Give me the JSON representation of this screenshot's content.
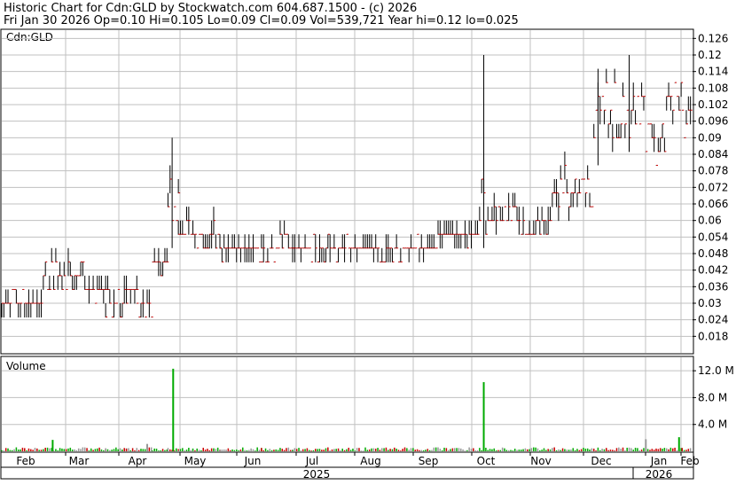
{
  "header": {
    "line1": "Historic Chart for Cdn:GLD by Stockwatch.com 604.687.1500 - (c) 2026",
    "line2": "Fri Jan 30 2026  Op=0.10  Hi=0.105  Lo=0.09  Cl=0.09  Vol=539,721  Year hi=0.12  lo=0.025"
  },
  "price_panel": {
    "label": "Cdn:GLD"
  },
  "volume_panel": {
    "label": "Volume"
  },
  "colors": {
    "up": "#00aa00",
    "down": "#cc0000",
    "neutral": "#999999",
    "grid": "#c0c0c0",
    "bar": "#000000",
    "close_tick": "#cc0000"
  },
  "chart_data": [
    {
      "type": "line",
      "subtype": "ohlc-bars",
      "title": "Historic Chart for Cdn:GLD by Stockwatch.com 604.687.1500 - (c) 2026",
      "ylabel": "",
      "ylim": [
        0.012,
        0.129
      ],
      "y_ticks": [
        0.126,
        0.12,
        0.114,
        0.108,
        0.102,
        0.096,
        0.09,
        0.084,
        0.078,
        0.072,
        0.066,
        0.06,
        0.054,
        0.048,
        0.042,
        0.036,
        0.03,
        0.024,
        0.018
      ],
      "y_axis_side": "right",
      "grid": true,
      "x_months": [
        "Feb",
        "Mar",
        "Apr",
        "May",
        "Jun",
        "Jul",
        "Aug",
        "Sep",
        "Oct",
        "Nov",
        "Dec",
        "Jan",
        "Feb"
      ],
      "x_years": [
        "2025",
        "2026"
      ],
      "period": "Jan 2025 - Jan 30 2026",
      "series": [
        {
          "name": "Cdn:GLD",
          "segments": [
            {
              "from": 0,
              "to": 4,
              "low": 0.025,
              "high": 0.035,
              "base": 0.03
            },
            {
              "from": 4,
              "to": 5,
              "low": 0.025,
              "high": 0.05,
              "base": 0.04
            },
            {
              "from": 5,
              "to": 8,
              "low": 0.035,
              "high": 0.05,
              "base": 0.04
            },
            {
              "from": 8,
              "to": 10,
              "low": 0.03,
              "high": 0.04,
              "base": 0.035
            },
            {
              "from": 10,
              "to": 12,
              "low": 0.025,
              "high": 0.04,
              "base": 0.03
            },
            {
              "from": 12,
              "to": 13,
              "low": 0.03,
              "high": 0.04,
              "base": 0.035
            },
            {
              "from": 13,
              "to": 14.5,
              "low": 0.025,
              "high": 0.04,
              "base": 0.03
            },
            {
              "from": 14.5,
              "to": 16,
              "low": 0.035,
              "high": 0.055,
              "base": 0.045
            },
            {
              "from": 16,
              "to": 17,
              "low": 0.05,
              "high": 0.09,
              "base": 0.065
            },
            {
              "from": 17,
              "to": 21,
              "low": 0.05,
              "high": 0.065,
              "base": 0.055
            },
            {
              "from": 21,
              "to": 25,
              "low": 0.045,
              "high": 0.055,
              "base": 0.05
            },
            {
              "from": 25,
              "to": 28,
              "low": 0.045,
              "high": 0.06,
              "base": 0.05
            },
            {
              "from": 28,
              "to": 32,
              "low": 0.045,
              "high": 0.055,
              "base": 0.05
            },
            {
              "from": 32,
              "to": 35,
              "low": 0.045,
              "high": 0.055,
              "base": 0.05
            },
            {
              "from": 35,
              "to": 39,
              "low": 0.04,
              "high": 0.055,
              "base": 0.048
            },
            {
              "from": 39,
              "to": 42,
              "low": 0.045,
              "high": 0.055,
              "base": 0.05
            },
            {
              "from": 42,
              "to": 46,
              "low": 0.05,
              "high": 0.06,
              "base": 0.055
            },
            {
              "from": 46,
              "to": 47,
              "low": 0.05,
              "high": 0.12,
              "base": 0.065
            },
            {
              "from": 47,
              "to": 50,
              "low": 0.055,
              "high": 0.07,
              "base": 0.062
            },
            {
              "from": 50,
              "to": 53,
              "low": 0.055,
              "high": 0.065,
              "base": 0.058
            },
            {
              "from": 53,
              "to": 57,
              "low": 0.06,
              "high": 0.085,
              "base": 0.072
            },
            {
              "from": 57,
              "to": 60,
              "low": 0.08,
              "high": 0.115,
              "base": 0.1
            },
            {
              "from": 60,
              "to": 62,
              "low": 0.085,
              "high": 0.12,
              "base": 0.1
            },
            {
              "from": 62,
              "to": 64,
              "low": 0.08,
              "high": 0.11,
              "base": 0.09
            },
            {
              "from": 64,
              "to": 65.5,
              "low": 0.09,
              "high": 0.12,
              "base": 0.105
            },
            {
              "from": 65.5,
              "to": 66.5,
              "low": 0.09,
              "high": 0.105,
              "base": 0.095
            }
          ]
        },
        {
          "name": "Volume",
          "ylim": [
            0,
            14000000
          ],
          "y_ticks": [
            12000000,
            8000000,
            4000000
          ],
          "y_tick_labels": [
            "12.0 M",
            "8.0 M",
            "4.0 M"
          ],
          "spikes": [
            {
              "x_pos": 4.9,
              "value": 1700000,
              "color": "up"
            },
            {
              "x_pos": 14.0,
              "value": 1100000,
              "color": "neutral"
            },
            {
              "x_pos": 16.5,
              "value": 12300000,
              "color": "up"
            },
            {
              "x_pos": 46.4,
              "value": 10300000,
              "color": "up"
            },
            {
              "x_pos": 62.0,
              "value": 1800000,
              "color": "neutral"
            },
            {
              "x_pos": 65.2,
              "value": 2100000,
              "color": "up"
            }
          ],
          "baseline_volume": 350000
        }
      ]
    }
  ]
}
